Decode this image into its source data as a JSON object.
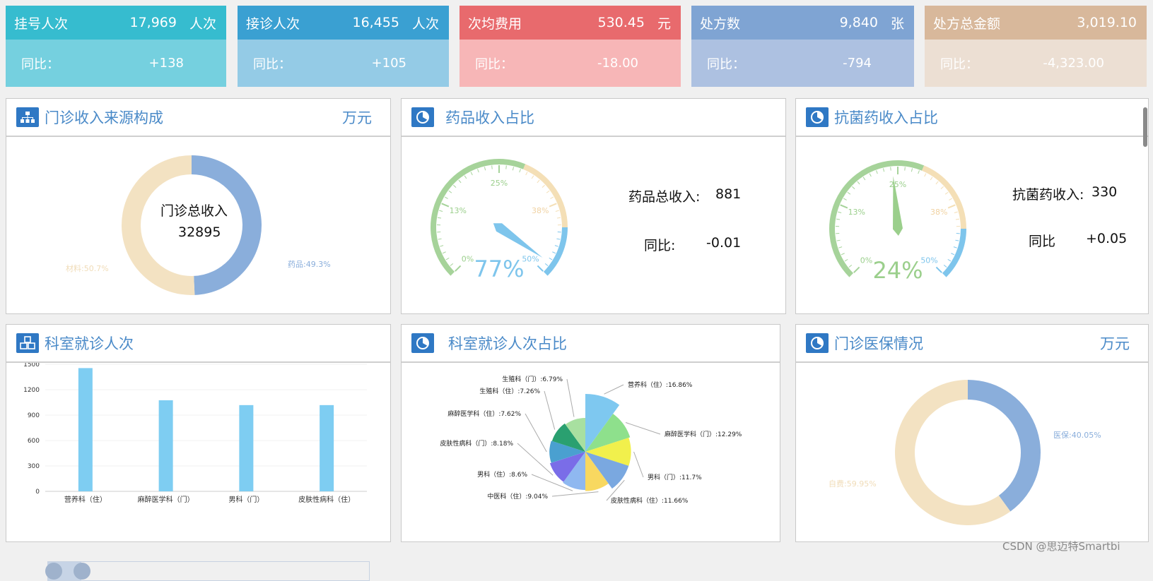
{
  "kpis": [
    {
      "title": "挂号人次",
      "value": "17,969",
      "unit": "人次",
      "yoy_label": "同比：",
      "yoy": "+138",
      "top_color": "#36bccf",
      "bot_color": "#75d0df"
    },
    {
      "title": "接诊人次",
      "value": "16,455",
      "unit": "人次",
      "yoy_label": "同比：",
      "yoy": "+105",
      "top_color": "#3aa0d2",
      "bot_color": "#94cbe6"
    },
    {
      "title": "次均费用",
      "value": "530.45",
      "unit": "元",
      "yoy_label": "同比：",
      "yoy": "-18.00",
      "top_color": "#e86a6d",
      "bot_color": "#f7b6b7"
    },
    {
      "title": "处方数",
      "value": "9,840",
      "unit": "张",
      "yoy_label": "同比：",
      "yoy": "-794",
      "top_color": "#7fa4d3",
      "bot_color": "#adc1e1"
    },
    {
      "title": "处方总金额",
      "value": "3,019.10",
      "unit": "",
      "yoy_label": "同比：",
      "yoy": "-4,323.00",
      "top_color": "#d8b89b",
      "bot_color": "#ecdfd3"
    }
  ],
  "panels": {
    "income_source": {
      "title": "门诊收入来源构成",
      "unit": "万元",
      "center_label": "门诊总收入",
      "center_value": "32895",
      "seg1_label": "药品:49.3%",
      "seg2_label": "材料:50.7%"
    },
    "drug_ratio": {
      "title": "药品收入占比",
      "gauge_value": "77%",
      "total_label": "药品总收入:",
      "total_value": "881",
      "yoy_label": "同比:",
      "yoy_value": "-0.01",
      "ticks": [
        "0%",
        "13%",
        "25%",
        "38%",
        "50%"
      ]
    },
    "antibiotic_ratio": {
      "title": "抗菌药收入占比",
      "gauge_value": "24%",
      "total_label": "抗菌药收入:",
      "total_value": "330",
      "yoy_label": "同比",
      "yoy_value": "+0.05",
      "ticks": [
        "0%",
        "13%",
        "25%",
        "38%",
        "50%"
      ]
    },
    "dept_visits": {
      "title": "科室就诊人次"
    },
    "dept_share": {
      "title": "科室就诊人次占比"
    },
    "insurance": {
      "title": "门诊医保情况",
      "unit": "万元",
      "seg1_label": "医保:40.05%",
      "seg2_label": "自费:59.95%"
    }
  },
  "chart_data": [
    {
      "type": "pie",
      "title": "",
      "categories": [
        "药品",
        "材料"
      ],
      "values": [
        49.3,
        50.7
      ],
      "colors": [
        "#8aaedb",
        "#f3e2c2"
      ]
    },
    {
      "type": "bar",
      "title": "",
      "categories": [
        "营养科（住）",
        "麻醉医学科（门）",
        "男科（门）",
        "皮肤性病科（住）"
      ],
      "values": [
        1455,
        1075,
        1018,
        1018
      ],
      "ylim": [
        0,
        1500
      ],
      "yticks": [
        "1500",
        "1200",
        "900",
        "600",
        "300",
        "0"
      ]
    },
    {
      "type": "pie",
      "title": "",
      "categories": [
        "营养科（住）:16.86%",
        "麻醉医学科（门）:12.29%",
        "男科（门）:11.7%",
        "皮肤性病科（住）:11.66%",
        "中医科（住）:9.04%",
        "男科（住）:8.6%",
        "皮肤性病科（门）:8.18%",
        "麻醉医学科（住）:7.62%",
        "生殖科（住）:7.26%",
        "生殖科（门）:6.79%"
      ],
      "values": [
        16.86,
        12.29,
        11.7,
        11.66,
        9.04,
        8.6,
        8.18,
        7.62,
        7.26,
        6.79
      ],
      "colors": [
        "#7ec8f0",
        "#8ee08c",
        "#f1f04c",
        "#7aa8e0",
        "#f8d860",
        "#8fb8f0",
        "#7a6de8",
        "#4aa0d0",
        "#2aa070",
        "#a8e0a0"
      ]
    },
    {
      "type": "pie",
      "title": "",
      "categories": [
        "医保",
        "自费"
      ],
      "values": [
        40.05,
        59.95
      ],
      "colors": [
        "#8aaedb",
        "#f3e2c2"
      ]
    }
  ],
  "watermark": "CSDN @思迈特Smartbi"
}
